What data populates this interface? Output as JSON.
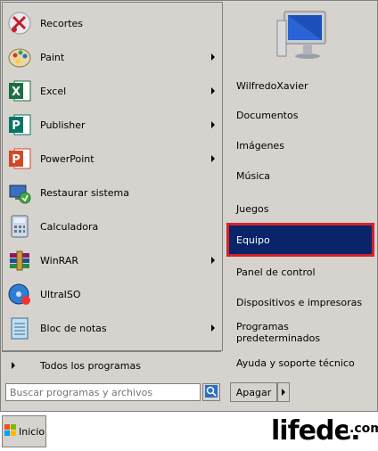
{
  "programs": [
    {
      "label": "Recortes",
      "icon": "scissors-icon",
      "has_submenu": false
    },
    {
      "label": "Paint",
      "icon": "paint-palette-icon",
      "has_submenu": true
    },
    {
      "label": "Excel",
      "icon": "excel-icon",
      "has_submenu": true
    },
    {
      "label": "Publisher",
      "icon": "publisher-icon",
      "has_submenu": true
    },
    {
      "label": "PowerPoint",
      "icon": "powerpoint-icon",
      "has_submenu": true
    },
    {
      "label": "Restaurar sistema",
      "icon": "system-restore-icon",
      "has_submenu": false
    },
    {
      "label": "Calculadora",
      "icon": "calculator-icon",
      "has_submenu": false
    },
    {
      "label": "WinRAR",
      "icon": "winrar-icon",
      "has_submenu": true
    },
    {
      "label": "UltraISO",
      "icon": "ultraiso-icon",
      "has_submenu": false
    },
    {
      "label": "Bloc de notas",
      "icon": "notepad-icon",
      "has_submenu": true
    }
  ],
  "all_programs": {
    "label": "Todos los programas"
  },
  "search": {
    "placeholder": "Buscar programas y archivos"
  },
  "places": [
    {
      "label": "WilfredoXavier"
    },
    {
      "label": "Documentos"
    },
    {
      "label": "Imágenes"
    },
    {
      "label": "Música"
    },
    {
      "label": "Juegos"
    },
    {
      "label": "Equipo",
      "selected": true
    },
    {
      "label": "Panel de control"
    },
    {
      "label": "Dispositivos e impresoras"
    },
    {
      "label": "Programas predeterminados"
    },
    {
      "label": "Ayuda y soporte técnico"
    }
  ],
  "shutdown": {
    "label": "Apagar"
  },
  "taskbar": {
    "start_label": "Inicio"
  },
  "watermark": {
    "brand": "lifeder",
    "suffix": ".com"
  },
  "colors": {
    "menu_bg": "#d6d3ce",
    "selection": "#0a246a",
    "highlight_border": "#d2232a"
  }
}
